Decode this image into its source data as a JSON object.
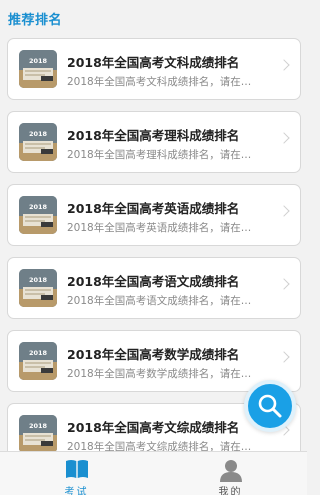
{
  "section": {
    "title": "推荐排名"
  },
  "cards": [
    {
      "title": "2018年全国高考文科成绩排名",
      "desc": "2018年全国高考文科成绩排名，请在…"
    },
    {
      "title": "2018年全国高考理科成绩排名",
      "desc": "2018年全国高考理科成绩排名，请在…"
    },
    {
      "title": "2018年全国高考英语成绩排名",
      "desc": "2018年全国高考英语成绩排名，请在…"
    },
    {
      "title": "2018年全国高考语文成绩排名",
      "desc": "2018年全国高考语文成绩排名，请在…"
    },
    {
      "title": "2018年全国高考数学成绩排名",
      "desc": "2018年全国高考数学成绩排名，请在…"
    },
    {
      "title": "2018年全国高考文综成绩排名",
      "desc": "2018年全国高考文综成绩排名，请在…"
    }
  ],
  "thumbnail": {
    "text": "2018",
    "icon": "exam-book-thumbnail"
  },
  "tabs": [
    {
      "label": "考试",
      "icon": "book-icon",
      "active": true
    },
    {
      "label": "我的",
      "icon": "user-icon",
      "active": false
    }
  ],
  "colors": {
    "accent": "#1a8fd0",
    "fab": "#1aa0e6",
    "background": "#f2f2f2"
  }
}
